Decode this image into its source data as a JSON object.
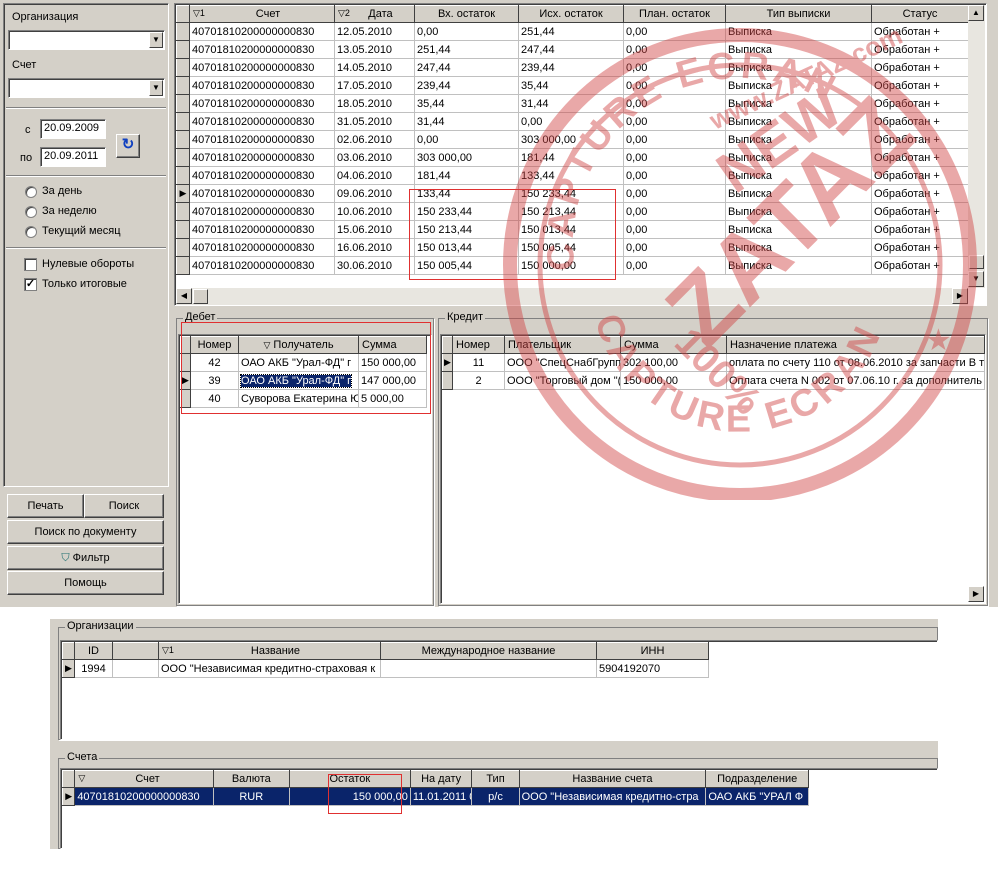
{
  "left": {
    "org_label": "Организация",
    "org_value": "",
    "account_label": "Счет",
    "account_value": "",
    "from_label": "с",
    "from_value": "20.09.2009",
    "to_label": "по",
    "to_value": "20.09.2011",
    "radios": [
      "За день",
      "За неделю",
      "Текущий месяц"
    ],
    "checks": [
      {
        "label": "Нулевые обороты",
        "checked": false
      },
      {
        "label": "Только итоговые",
        "checked": true
      }
    ],
    "buttons": {
      "print": "Печать",
      "search": "Поиск",
      "search_doc": "Поиск по документу",
      "filter": "Фильтр",
      "help": "Помощь"
    }
  },
  "statements": {
    "columns": [
      "Счет",
      "Дата",
      "Вх. остаток",
      "Исх. остаток",
      "План. остаток",
      "Тип выписки",
      "Статус"
    ],
    "sort_marks": [
      "▽1",
      "▽2"
    ],
    "rows": [
      [
        "40701810200000000830",
        "12.05.2010",
        "0,00",
        "251,44",
        "0,00",
        "Выписка",
        "Обработан +"
      ],
      [
        "40701810200000000830",
        "13.05.2010",
        "251,44",
        "247,44",
        "0,00",
        "Выписка",
        "Обработан +"
      ],
      [
        "40701810200000000830",
        "14.05.2010",
        "247,44",
        "239,44",
        "0,00",
        "Выписка",
        "Обработан +"
      ],
      [
        "40701810200000000830",
        "17.05.2010",
        "239,44",
        "35,44",
        "0,00",
        "Выписка",
        "Обработан +"
      ],
      [
        "40701810200000000830",
        "18.05.2010",
        "35,44",
        "31,44",
        "0,00",
        "Выписка",
        "Обработан +"
      ],
      [
        "40701810200000000830",
        "31.05.2010",
        "31,44",
        "0,00",
        "0,00",
        "Выписка",
        "Обработан +"
      ],
      [
        "40701810200000000830",
        "02.06.2010",
        "0,00",
        "303 000,00",
        "0,00",
        "Выписка",
        "Обработан +"
      ],
      [
        "40701810200000000830",
        "03.06.2010",
        "303 000,00",
        "181,44",
        "0,00",
        "Выписка",
        "Обработан +"
      ],
      [
        "40701810200000000830",
        "04.06.2010",
        "181,44",
        "133,44",
        "0,00",
        "Выписка",
        "Обработан +"
      ],
      [
        "40701810200000000830",
        "09.06.2010",
        "133,44",
        "150 233,44",
        "0,00",
        "Выписка",
        "Обработан +"
      ],
      [
        "40701810200000000830",
        "10.06.2010",
        "150 233,44",
        "150 213,44",
        "0,00",
        "Выписка",
        "Обработан +"
      ],
      [
        "40701810200000000830",
        "15.06.2010",
        "150 213,44",
        "150 013,44",
        "0,00",
        "Выписка",
        "Обработан +"
      ],
      [
        "40701810200000000830",
        "16.06.2010",
        "150 013,44",
        "150 005,44",
        "0,00",
        "Выписка",
        "Обработан +"
      ],
      [
        "40701810200000000830",
        "30.06.2010",
        "150 005,44",
        "150 000,00",
        "0,00",
        "Выписка",
        "Обработан +"
      ]
    ],
    "current_row": 9
  },
  "debit": {
    "caption": "Дебет",
    "columns": [
      "Номер",
      "Получатель",
      "Сумма"
    ],
    "rows": [
      [
        "42",
        "ОАО АКБ \"Урал-ФД\" г",
        "150 000,00"
      ],
      [
        "39",
        "ОАО АКБ \"Урал-ФД\" г",
        "147 000,00"
      ],
      [
        "40",
        "Суворова Екатерина Ю",
        "5 000,00"
      ]
    ],
    "current_row": 1
  },
  "credit": {
    "caption": "Кредит",
    "columns": [
      "Номер",
      "Плательщик",
      "Сумма",
      "Назначение платежа"
    ],
    "rows": [
      [
        "11",
        "ООО \"СпецСнабГрупп\"",
        "302 100,00",
        "оплата по счету 110 от 08.06.2010 за запчасти В т"
      ],
      [
        "2",
        "ООО \"Торговый дом \"(",
        "150 000,00",
        "Оплата счета N 002 от 07.06.10 г. за дополнитель"
      ]
    ],
    "current_row": 0
  },
  "orgs": {
    "caption": "Организации",
    "columns": [
      "ID",
      "",
      "Название",
      "Международное название",
      "ИНН"
    ],
    "sort_mark": "▽1",
    "rows": [
      [
        "1994",
        "",
        "ООО \"Независимая кредитно-страховая к",
        "",
        "5904192070"
      ]
    ]
  },
  "accounts": {
    "caption": "Счета",
    "columns": [
      "Счет",
      "Валюта",
      "Остаток",
      "На дату",
      "Тип",
      "Название счета",
      "Подразделение"
    ],
    "sort_mark": "▽",
    "rows": [
      [
        "40701810200000000830",
        "RUR",
        "150 000,00",
        "11.01.2011 0",
        "р/с",
        "ООО \"Независимая кредитно-стра",
        "ОАО АКБ \"УРАЛ Ф"
      ]
    ]
  },
  "watermark": {
    "lines": [
      "CAPTURE ECRAN",
      "www.ZATAZ.com",
      "NEW",
      "ZATAZ",
      "100%",
      "CAPTURE ECRAN"
    ]
  },
  "colors": {
    "panel": "#d4d0c8",
    "selection": "#0a246a",
    "annotation": "#e03030",
    "stamp": "#d04040"
  }
}
